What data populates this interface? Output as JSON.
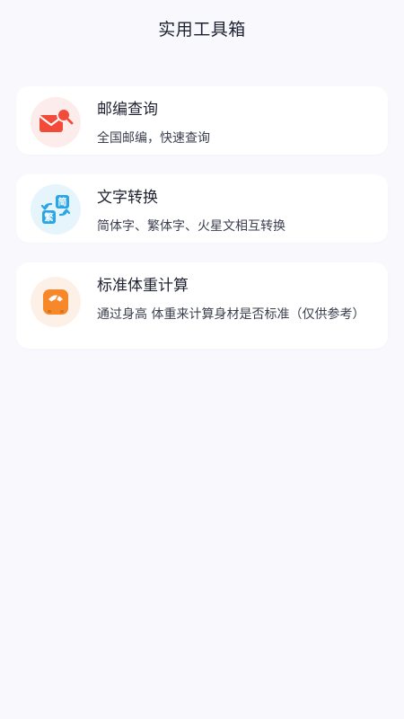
{
  "header": {
    "title": "实用工具箱"
  },
  "tools": [
    {
      "title": "邮编查询",
      "description": "全国邮编，快速查询",
      "icon": "envelope-search-icon",
      "icon_bg": "#fdecec",
      "icon_color": "#f24b3a"
    },
    {
      "title": "文字转换",
      "description": "简体字、繁体字、火星文相互转换",
      "icon": "text-convert-icon",
      "icon_bg": "#e6f4fc",
      "icon_color": "#2aa5e6",
      "icon_labels": [
        "简",
        "繁"
      ]
    },
    {
      "title": "标准体重计算",
      "description": "通过身高 体重来计算身材是否标准（仅供参考）",
      "icon": "weight-scale-icon",
      "icon_bg": "#fdf0e6",
      "icon_color": "#f7882a"
    }
  ]
}
